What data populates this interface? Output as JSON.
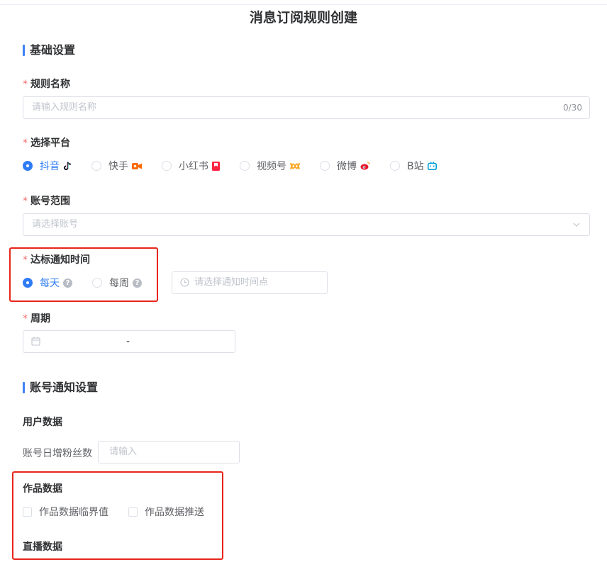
{
  "page": {
    "title": "消息订阅规则创建"
  },
  "basic": {
    "section_title": "基础设置",
    "rule_name": {
      "label": "规则名称",
      "required": "*",
      "placeholder": "请输入规则名称",
      "counter": "0/30"
    },
    "platform": {
      "label": "选择平台",
      "required": "*",
      "options": [
        {
          "label": "抖音",
          "icon": "douyin-icon",
          "selected": true
        },
        {
          "label": "快手",
          "icon": "kuaishou-icon",
          "selected": false
        },
        {
          "label": "小红书",
          "icon": "xiaohongshu-icon",
          "selected": false
        },
        {
          "label": "视频号",
          "icon": "shipinhao-icon",
          "selected": false
        },
        {
          "label": "微博",
          "icon": "weibo-icon",
          "selected": false
        },
        {
          "label": "B站",
          "icon": "bilibili-icon",
          "selected": false
        }
      ]
    },
    "account": {
      "label": "账号范围",
      "required": "*",
      "placeholder": "请选择账号"
    },
    "notify_time": {
      "label": "达标通知时间",
      "required": "*",
      "options": [
        {
          "label": "每天",
          "selected": true
        },
        {
          "label": "每周",
          "selected": false
        }
      ],
      "time_placeholder": "请选择通知时间点"
    },
    "period": {
      "label": "周期",
      "required": "*",
      "separator": "-"
    }
  },
  "account_notify": {
    "section_title": "账号通知设置",
    "user_data": {
      "title": "用户数据",
      "fans_label": "账号日增粉丝数",
      "fans_placeholder": "请输入"
    },
    "works_data": {
      "title": "作品数据",
      "options": [
        "作品数据临界值",
        "作品数据推送"
      ]
    },
    "live_data": {
      "title": "直播数据"
    }
  },
  "colors": {
    "primary": "#2f7cf6",
    "required": "#f56c6c",
    "highlight_box": "#e8251a"
  }
}
